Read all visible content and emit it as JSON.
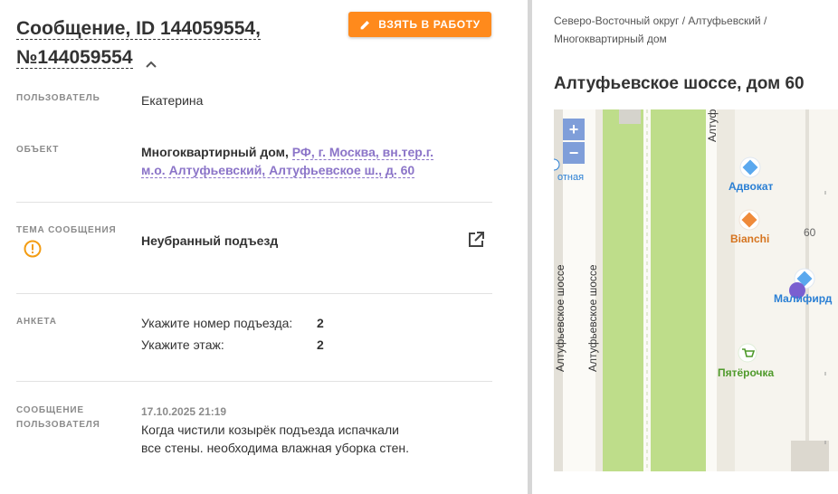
{
  "header": {
    "title_line1": "Сообщение, ID 144059554,",
    "title_line2": "№144059554",
    "take_button": "ВЗЯТЬ В РАБОТУ"
  },
  "fields": {
    "user_label": "ПОЛЬЗОВАТЕЛЬ",
    "user_value": "Екатерина",
    "object_label": "ОБЪЕКТ",
    "object_type": "Многоквартирный дом,",
    "object_address": "РФ, г. Москва, вн.тер.г. м.о. Алтуфьевский, Алтуфьевское ш., д. 60",
    "topic_label": "ТЕМА СООБЩЕНИЯ",
    "topic_value": "Неубранный подъезд",
    "anketa_label": "АНКЕТА",
    "anketa": [
      {
        "q": "Укажите номер подъезда:",
        "a": "2"
      },
      {
        "q": "Укажите этаж:",
        "a": "2"
      }
    ],
    "message_label": "СООБЩЕНИЕ ПОЛЬЗОВАТЕЛЯ",
    "message_date": "17.10.2025 21:19",
    "message_text": "Когда чистили козырёк подъезда испачкали все стены. необходима влажная уборка стен."
  },
  "location": {
    "breadcrumb": "Северо-Восточный округ / Алтуфьевский / Многоквартирный дом",
    "address": "Алтуфьевское шоссе, дом 60"
  },
  "map": {
    "zoom_in": "+",
    "zoom_out": "−",
    "street_1": "Алтуфьевское шоссе",
    "street_2": "Алтуфьевское шоссе",
    "street_3": "Алтуфь",
    "poi_partial": "отная",
    "poi_1": "Адвокат",
    "poi_2": "Bianchi",
    "poi_3": "Малифирд",
    "poi_4": "Пятёрочка",
    "house_number": "60"
  },
  "colors": {
    "accent": "#ff8a1c",
    "link": "#8b74c8",
    "warning": "#f39c12",
    "poi_blue": "#2a7fd4",
    "poi_orange": "#d6741f",
    "poi_green": "#4f9a2b",
    "map_green": "#bedd8a",
    "marker": "#7a5fd0"
  }
}
